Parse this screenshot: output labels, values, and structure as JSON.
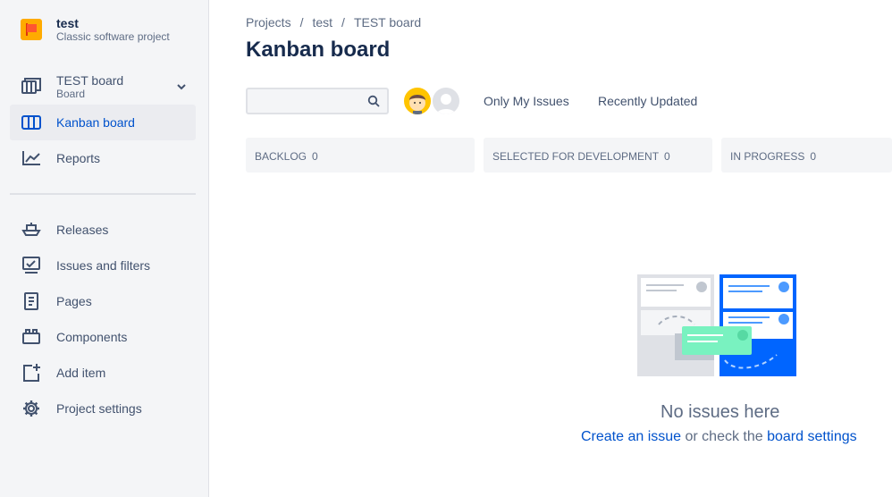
{
  "project": {
    "name": "test",
    "type": "Classic software project"
  },
  "sidebar": {
    "board_selector": {
      "title": "TEST board",
      "subtitle": "Board"
    },
    "top_items": [
      {
        "label": "Kanban board",
        "icon": "kanban-board-icon",
        "active": true
      },
      {
        "label": "Reports",
        "icon": "reports-icon"
      }
    ],
    "items": [
      {
        "label": "Releases",
        "icon": "releases-ship-icon"
      },
      {
        "label": "Issues and filters",
        "icon": "issues-filters-icon"
      },
      {
        "label": "Pages",
        "icon": "pages-icon"
      },
      {
        "label": "Components",
        "icon": "components-icon"
      },
      {
        "label": "Add item",
        "icon": "add-item-icon"
      },
      {
        "label": "Project settings",
        "icon": "gear-icon"
      }
    ]
  },
  "breadcrumb": [
    "Projects",
    "test",
    "TEST board"
  ],
  "page_title": "Kanban board",
  "search": {
    "value": "",
    "placeholder": ""
  },
  "quick_filters": [
    "Only My Issues",
    "Recently Updated"
  ],
  "columns": [
    {
      "name": "BACKLOG",
      "count": "0"
    },
    {
      "name": "SELECTED FOR DEVELOPMENT",
      "count": "0"
    },
    {
      "name": "IN PROGRESS",
      "count": "0"
    }
  ],
  "empty_state": {
    "title": "No issues here",
    "create_link": "Create an issue",
    "middle_text": " or check the ",
    "settings_link": "board settings"
  },
  "colors": {
    "accent": "#0052cc",
    "sidebar_bg": "#f4f5f7",
    "text": "#172b4d"
  }
}
